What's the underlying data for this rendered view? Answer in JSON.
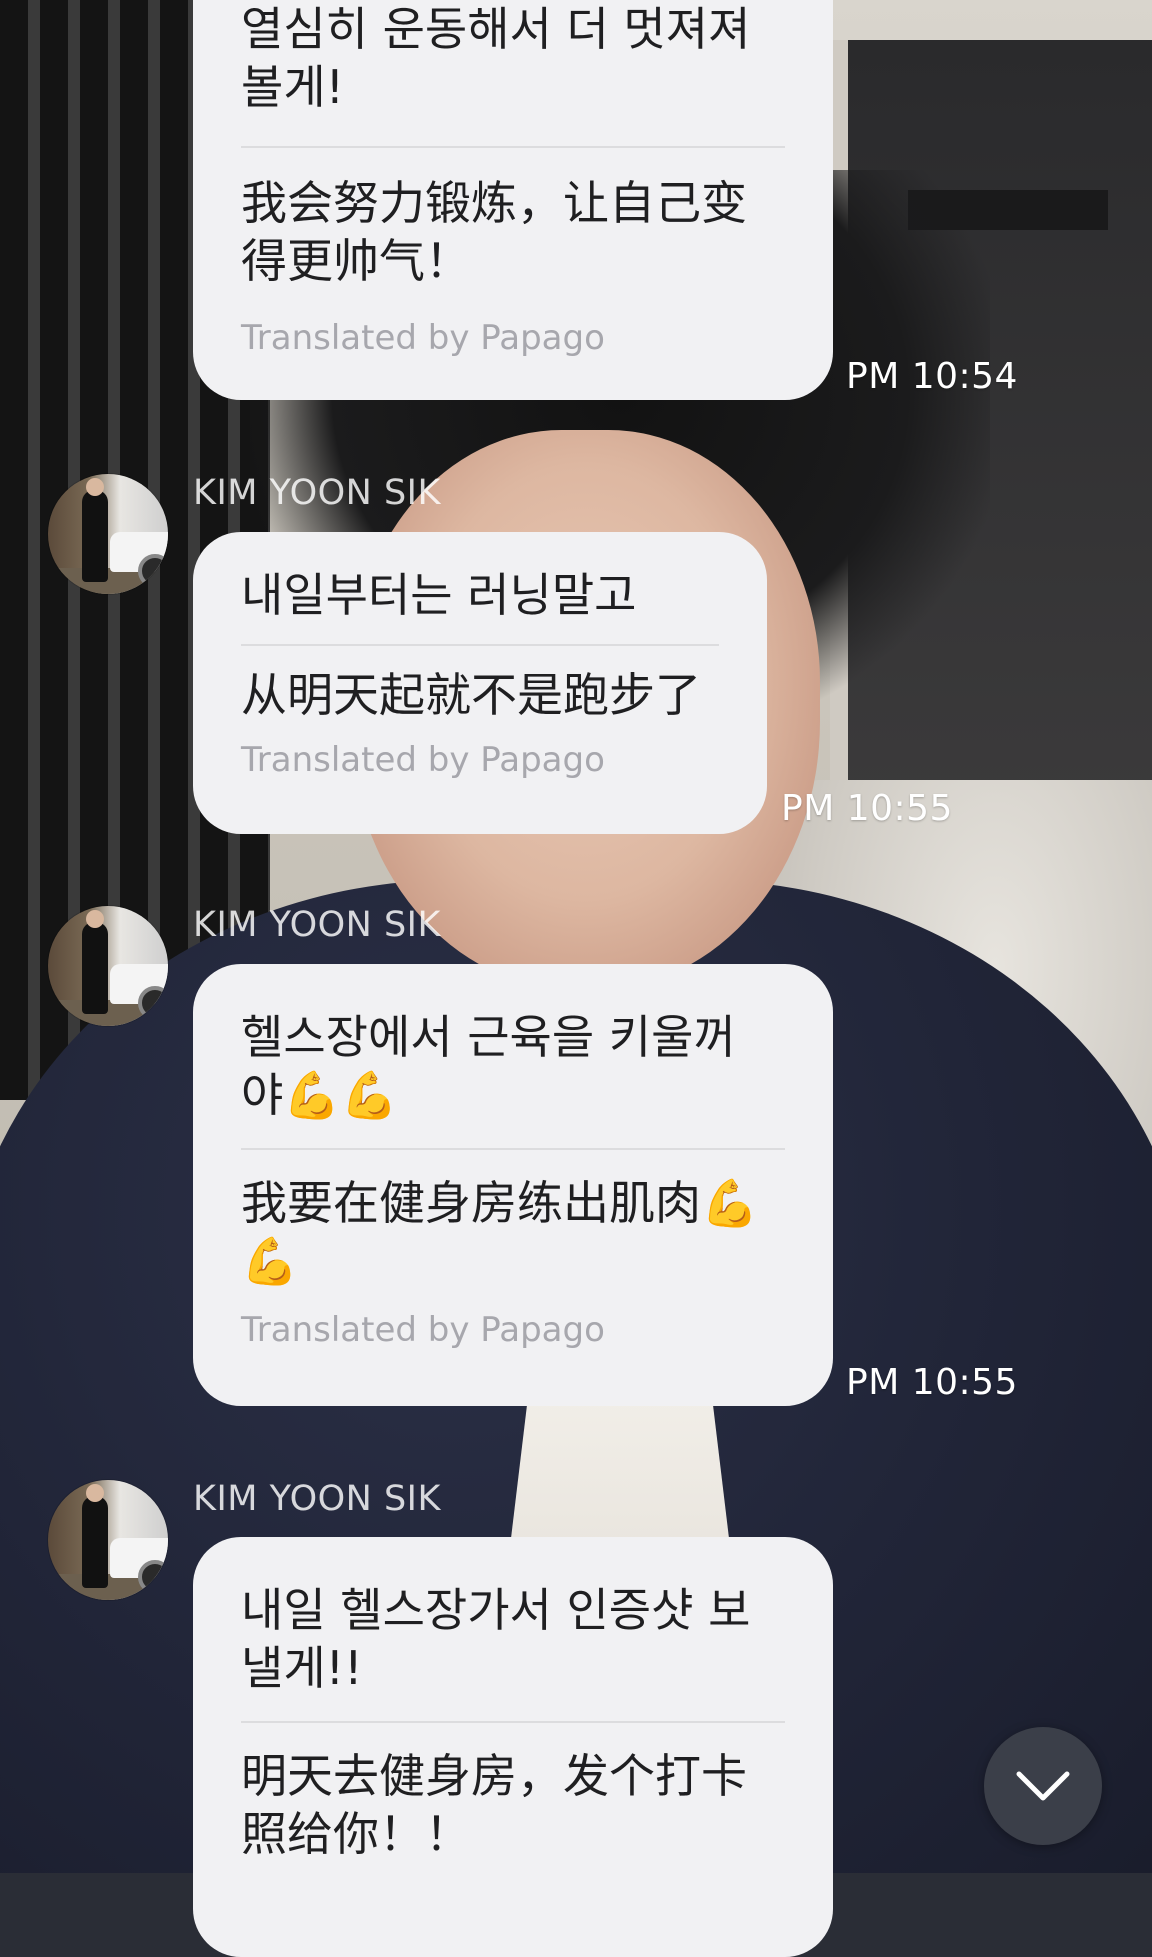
{
  "chat": {
    "sender_name": "KIM YOON SIK",
    "translator_label": "Translated by Papago",
    "messages": [
      {
        "original_lines": [
          "열심히 운동해서 더 멋져져",
          "볼게!"
        ],
        "translation_lines": [
          "我会努力锻炼，让自己变",
          "得更帅气！"
        ],
        "time": "PM 10:54"
      },
      {
        "original_lines": [
          "내일부터는 러닝말고"
        ],
        "translation_lines": [
          "从明天起就不是跑步了"
        ],
        "time": "PM 10:55"
      },
      {
        "original_lines": [
          "헬스장에서 근육을 키울꺼",
          "야💪💪"
        ],
        "translation_lines": [
          "我要在健身房练出肌肉💪",
          "💪"
        ],
        "time": "PM 10:55"
      },
      {
        "original_lines": [
          "내일 헬스장가서 인증샷 보",
          "낼게!!"
        ],
        "translation_lines": [
          "明天去健身房，发个打卡",
          "照给你！！"
        ]
      }
    ]
  },
  "icons": {
    "scroll_down": "chevron-down-icon",
    "avatar": "profile-photo"
  }
}
